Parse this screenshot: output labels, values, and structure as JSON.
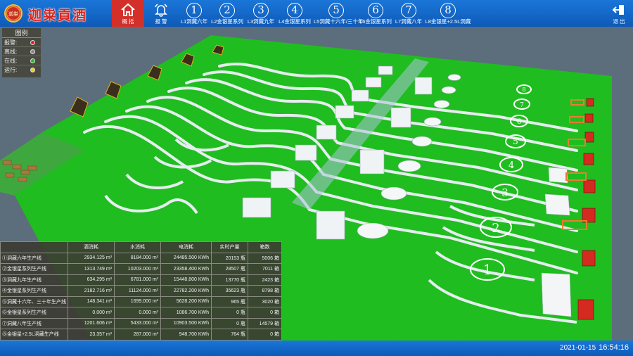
{
  "header": {
    "brand": "迦粜貢酒",
    "seal_text": "迦粜",
    "nav": [
      {
        "icon": "home-icon",
        "label": "概 括",
        "active": true
      },
      {
        "icon": "bell-icon",
        "label": "报 警"
      },
      {
        "num": "①",
        "label": "L1洞藏六年"
      },
      {
        "num": "②",
        "label": "L2金银星系列"
      },
      {
        "num": "③",
        "label": "L3洞藏九年"
      },
      {
        "num": "④",
        "label": "L4金银星系列"
      },
      {
        "num": "⑤",
        "label": "L5洞藏十六年/三十年"
      },
      {
        "num": "⑥",
        "label": "L6金银星系列"
      },
      {
        "num": "⑦",
        "label": "L7洞藏八年"
      },
      {
        "num": "⑧",
        "label": "L8金银星+2.5L洞藏"
      }
    ],
    "exit_label": "退 出",
    "colors": {
      "bar": "#1369cc",
      "active": "#d4302a"
    }
  },
  "legend": {
    "title": "图例",
    "items": [
      {
        "label": "报警:",
        "color": "#e02020"
      },
      {
        "label": "离线:",
        "color": "#888888"
      },
      {
        "label": "在线:",
        "color": "#20c020"
      },
      {
        "label": "运行:",
        "color": "#e8d020"
      }
    ]
  },
  "stats": {
    "headers": [
      "",
      "酒消耗",
      "水消耗",
      "电消耗",
      "实时产量",
      "箱数"
    ],
    "rows": [
      [
        "①洞藏六年生产线",
        "2934.125 m³",
        "8184.000 m³",
        "24485.500 KWh",
        "20153 瓶",
        "5006 箱"
      ],
      [
        "②金银星系列生产线",
        "1313.749 m³",
        "10203.000 m³",
        "23358.400 KWh",
        "28507 瓶",
        "7011 箱"
      ],
      [
        "③洞藏九年生产线",
        "634.295 m³",
        "6781.000 m³",
        "15448.800 KWh",
        "13770 瓶",
        "2423 箱"
      ],
      [
        "④金银星系列生产线",
        "2182.716 m³",
        "11124.000 m³",
        "22782.200 KWh",
        "35623 瓶",
        "8798 箱"
      ],
      [
        "⑤洞藏十六年、三十年生产线",
        "148.341 m³",
        "1699.000 m³",
        "5628.200 KWh",
        "965 瓶",
        "3020 箱"
      ],
      [
        "⑥金银星系列生产线",
        "0.000 m³",
        "0.000 m³",
        "1086.700 KWh",
        "0 瓶",
        "0 箱"
      ],
      [
        "⑦洞藏八年生产线",
        "1201.606 m³",
        "5433.000 m³",
        "10903.500 KWh",
        "0 瓶",
        "14579 箱"
      ],
      [
        "⑧金银星+2.5L洞藏生产线",
        "23.357 m³",
        "287.000 m³",
        "948.700 KWh",
        "764 瓶",
        "0 箱"
      ]
    ]
  },
  "scene": {
    "line_numbers": [
      "1",
      "2",
      "3",
      "4",
      "5",
      "6",
      "7",
      "8"
    ],
    "colors": {
      "floor": "#1fbd1f",
      "ground": "#5c6d7c",
      "conveyor": "#e6ecef",
      "forklift": "#d42a20",
      "divider": "#aac4d6"
    }
  },
  "status": {
    "date": "2021-01-15",
    "time": "16:54:16"
  }
}
